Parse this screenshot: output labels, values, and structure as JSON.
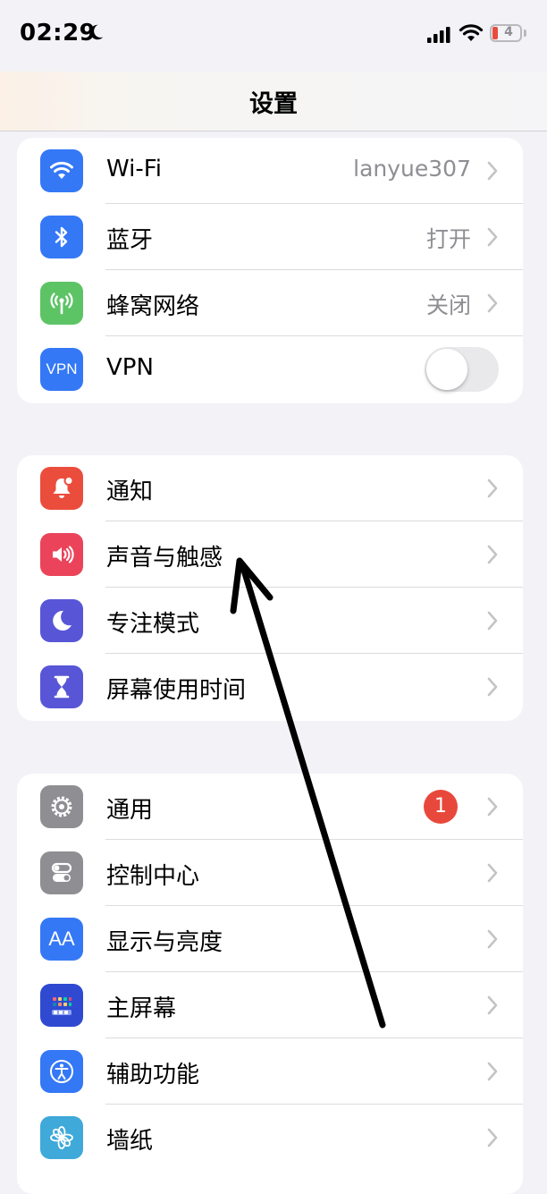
{
  "status_bar": {
    "time": "02:29",
    "battery": "4",
    "icons": [
      "moon-icon",
      "cellular-signal-icon",
      "wifi-icon",
      "battery-icon"
    ]
  },
  "nav": {
    "title": "设置"
  },
  "groups": [
    {
      "rows": [
        {
          "label": "Wi-Fi",
          "value": "lanyue307",
          "icon": "wifi-icon",
          "color": "#3478f6"
        },
        {
          "label": "蓝牙",
          "value": "打开",
          "icon": "bluetooth-icon",
          "color": "#3478f6"
        },
        {
          "label": "蜂窝网络",
          "value": "关闭",
          "icon": "cellular-antenna-icon",
          "color": "#5dc466"
        },
        {
          "label": "VPN",
          "icon_text": "VPN",
          "toggle": false,
          "icon": "vpn-icon",
          "color": "#3478f6"
        }
      ]
    },
    {
      "rows": [
        {
          "label": "通知",
          "icon": "bell-icon",
          "color": "#eb4d3d"
        },
        {
          "label": "声音与触感",
          "icon": "speaker-icon",
          "color": "#eb445a"
        },
        {
          "label": "专注模式",
          "icon": "moon-icon",
          "color": "#5856d6"
        },
        {
          "label": "屏幕使用时间",
          "icon": "hourglass-icon",
          "color": "#5856d6"
        }
      ]
    },
    {
      "rows": [
        {
          "label": "通用",
          "badge": "1",
          "icon": "gear-icon",
          "color": "#8e8e93"
        },
        {
          "label": "控制中心",
          "icon": "switches-icon",
          "color": "#8e8e93"
        },
        {
          "label": "显示与亮度",
          "icon_text": "AA",
          "icon": "text-size-icon",
          "color": "#3478f6"
        },
        {
          "label": "主屏幕",
          "icon": "home-grid-icon",
          "color": "#2f4ad1"
        },
        {
          "label": "辅助功能",
          "icon": "accessibility-icon",
          "color": "#3478f6"
        },
        {
          "label": "墙纸",
          "icon": "flower-icon",
          "color": "#3fa9d9"
        }
      ]
    }
  ],
  "annotation": {
    "icon": "hand-drawn-arrow"
  }
}
